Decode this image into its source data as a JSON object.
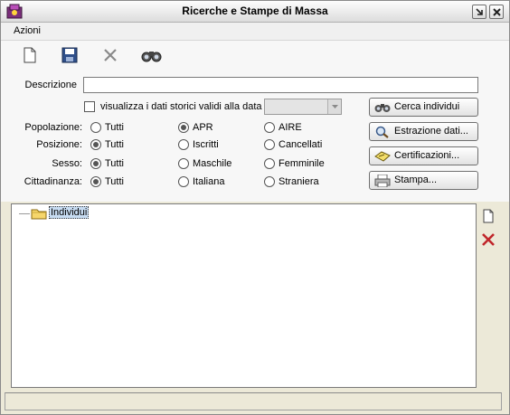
{
  "window": {
    "title": "Ricerche e Stampe di Massa",
    "icon": "app-icon",
    "controls": [
      "minimize-icon",
      "close-icon"
    ]
  },
  "menu": {
    "items": [
      {
        "label": "Azioni"
      }
    ]
  },
  "toolbar": {
    "tools": [
      "new-document-icon",
      "save-disk-icon",
      "delete-x-icon",
      "binoculars-icon"
    ]
  },
  "form": {
    "descrizione_label": "Descrizione",
    "descrizione_value": "",
    "storici_checkbox_label": "visualizza i dati storici validi alla data",
    "storici_checked": false,
    "storici_date_value": "",
    "rows": [
      {
        "label": "Popolazione:",
        "options": [
          "Tutti",
          "APR",
          "AIRE"
        ],
        "selected": "APR"
      },
      {
        "label": "Posizione:",
        "options": [
          "Tutti",
          "Iscritti",
          "Cancellati"
        ],
        "selected": "Tutti"
      },
      {
        "label": "Sesso:",
        "options": [
          "Tutti",
          "Maschile",
          "Femminile"
        ],
        "selected": "Tutti"
      },
      {
        "label": "Cittadinanza:",
        "options": [
          "Tutti",
          "Italiana",
          "Straniera"
        ],
        "selected": "Tutti"
      }
    ]
  },
  "buttons": {
    "cerca": "Cerca individui",
    "estrazione": "Estrazione dati...",
    "certificazioni": "Certificazioni...",
    "stampa": "Stampa..."
  },
  "tree": {
    "root_label": "Individui",
    "root_icon": "folder-icon",
    "selected": true
  },
  "side_actions": [
    "new-item-icon",
    "remove-x-icon"
  ],
  "status": {
    "text": ""
  },
  "colors": {
    "window_bg": "#ece9d8",
    "panel_bg": "#f7f7f7",
    "delete_red": "#c0262b",
    "selection": "#c7dcf2"
  }
}
